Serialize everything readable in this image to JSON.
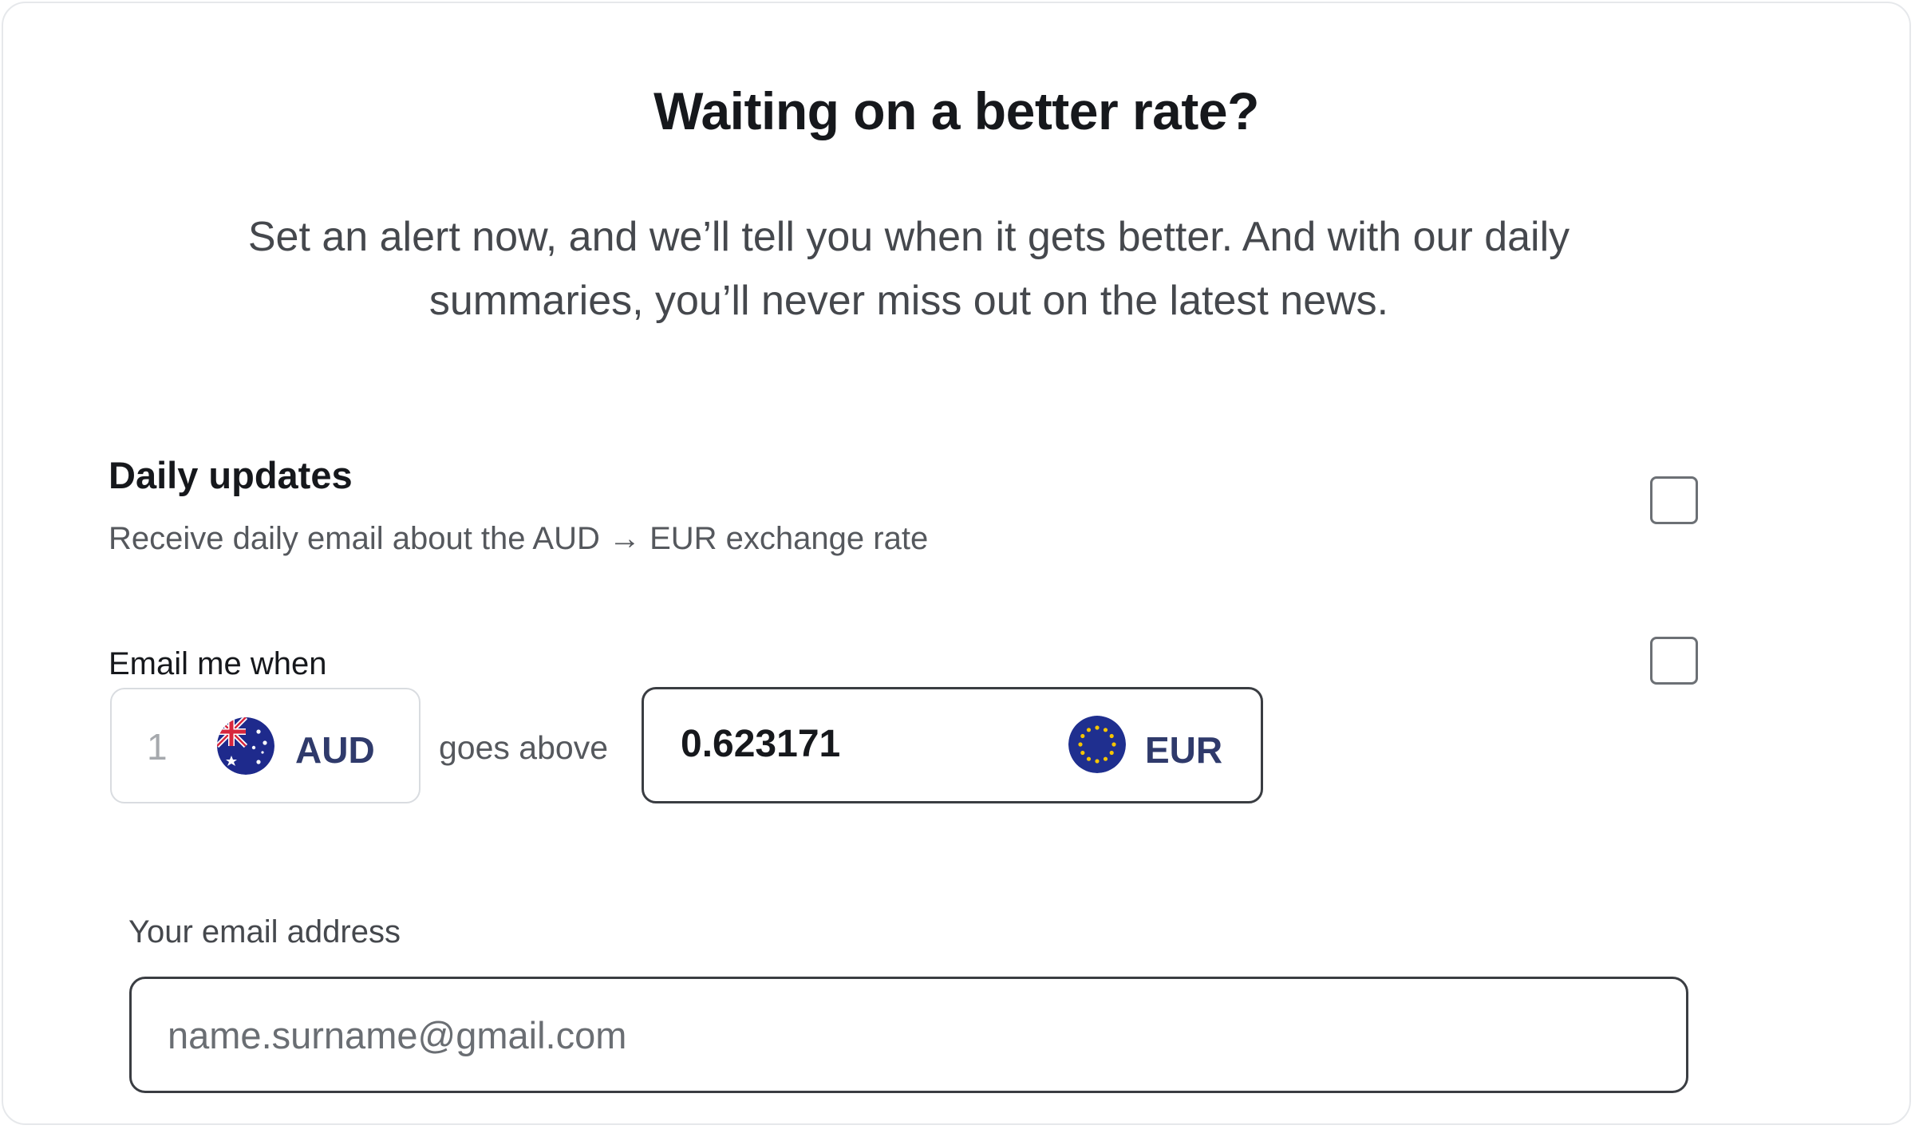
{
  "header": {
    "title": "Waiting on a better rate?",
    "subtitle": "Set an alert now, and we’ll tell you when it gets better. And with our daily summaries, you’ll never miss out on the latest news."
  },
  "daily_updates": {
    "title": "Daily updates",
    "description": "Receive daily email about the AUD → EUR exchange rate",
    "checked": false
  },
  "rate_alert": {
    "label": "Email me when",
    "checked": false,
    "from": {
      "amount": "1",
      "currency": "AUD",
      "flag_icon": "australia-flag-icon"
    },
    "condition": "goes above",
    "to": {
      "rate": "0.623171",
      "currency": "EUR",
      "flag_icon": "eu-flag-icon"
    }
  },
  "email": {
    "label": "Your email address",
    "placeholder": "name.surname@gmail.com",
    "value": ""
  },
  "colors": {
    "currency_text": "#2f3a6b",
    "eu_blue": "#1f2f8f",
    "eu_star": "#f5c400",
    "au_blue": "#1e2a8c",
    "au_red": "#d7263d"
  }
}
